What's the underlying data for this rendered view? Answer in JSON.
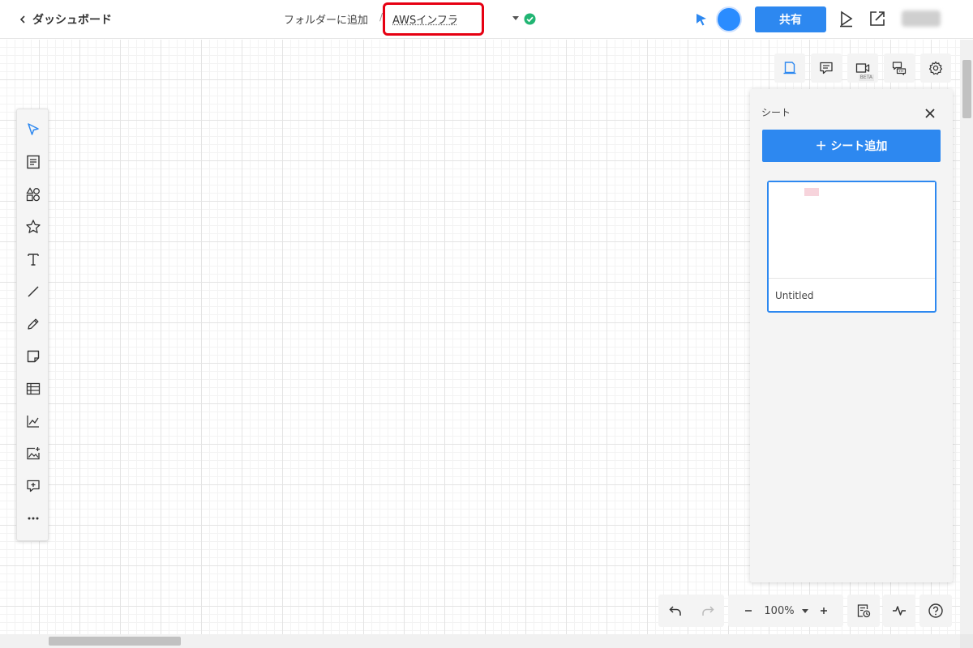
{
  "header": {
    "back_label": "ダッシュボード",
    "folder_add_label": "フォルダーに追加",
    "separator": "/",
    "document_title": "AWSインフラ"
  },
  "actions": {
    "share_label": "共有"
  },
  "icons": {
    "back": "chevron-left-icon",
    "title_dropdown": "caret-down-icon",
    "saved": "check-circle-icon",
    "pointer": "cursor-pointer-icon",
    "play": "play-icon",
    "export": "export-icon"
  },
  "toolbar": {
    "tools": [
      "select",
      "template",
      "shapes",
      "star",
      "text",
      "line",
      "pen",
      "sticky-note",
      "table",
      "chart",
      "image",
      "comment",
      "more"
    ]
  },
  "right_icons": {
    "items": [
      "sheets",
      "comments",
      "video",
      "chat",
      "settings"
    ],
    "video_badge": "BETA"
  },
  "sheets_panel": {
    "title": "シート",
    "add_label": "＋ シート追加",
    "sheets": [
      {
        "name": "Untitled",
        "selected": true
      }
    ]
  },
  "bottom": {
    "zoom": "100%"
  },
  "colors": {
    "accent": "#2d88f0",
    "highlight": "#e60012",
    "saved_green": "#21b573"
  }
}
